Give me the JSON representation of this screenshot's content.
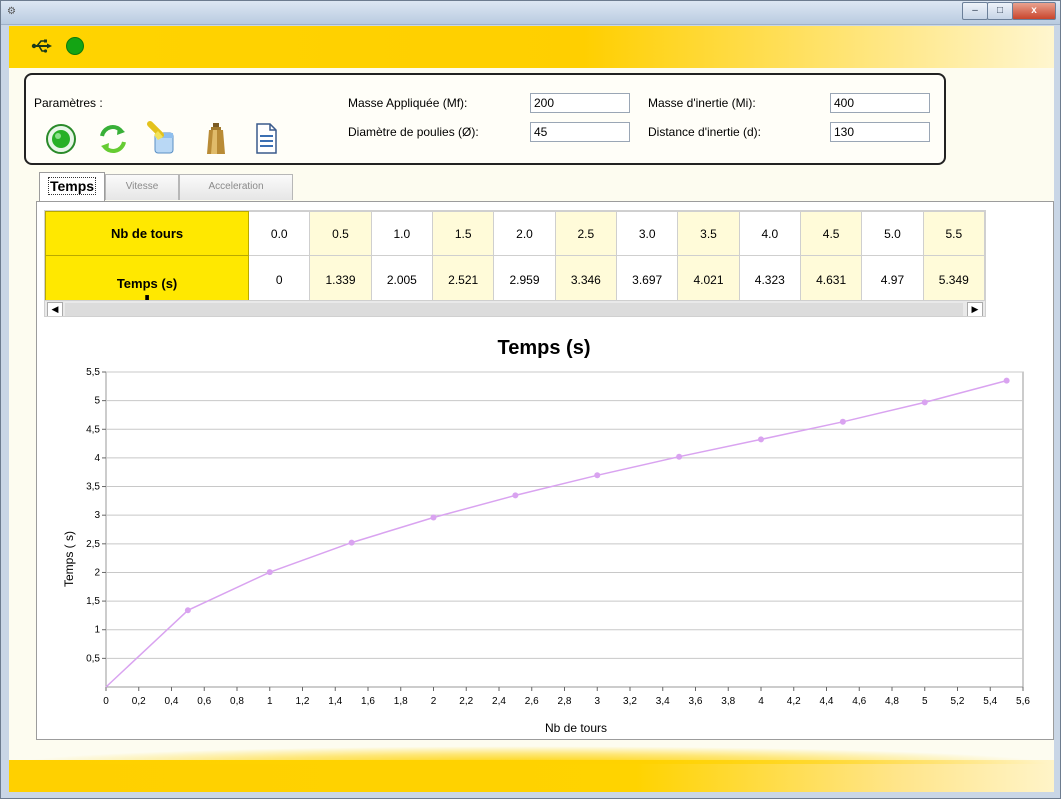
{
  "window": {
    "title": "",
    "buttons": {
      "minimize": "–",
      "maximize": "□",
      "close": "x"
    }
  },
  "header": {
    "status_color": "#14a414"
  },
  "params": {
    "title": "Paramètres :",
    "tools": [
      "start-icon",
      "refresh-icon",
      "clear-icon",
      "weight-icon",
      "document-icon"
    ],
    "fields": [
      {
        "label": "Masse Appliquée (Mf):",
        "value": "200"
      },
      {
        "label": "Masse d'inertie (Mi):",
        "value": "400"
      },
      {
        "label": "Diamètre de poulies (Ø):",
        "value": "45"
      },
      {
        "label": "Distance d'inertie (d):",
        "value": "130"
      }
    ]
  },
  "tabs": [
    {
      "label": "Temps",
      "active": true
    },
    {
      "label": "Vitesse",
      "active": false
    },
    {
      "label": "Acceleration",
      "active": false
    }
  ],
  "table": {
    "row_headers": [
      "Nb de tours",
      "Temps (s)"
    ],
    "nb_tours": [
      "0.0",
      "0.5",
      "1.0",
      "1.5",
      "2.0",
      "2.5",
      "3.0",
      "3.5",
      "4.0",
      "4.5",
      "5.0",
      "5.5"
    ],
    "temps": [
      "0",
      "1.339",
      "2.005",
      "2.521",
      "2.959",
      "3.346",
      "3.697",
      "4.021",
      "4.323",
      "4.631",
      "4.97",
      "5.349"
    ]
  },
  "chart_data": {
    "type": "line",
    "title": "Temps (s)",
    "xlabel": "Nb de tours",
    "ylabel": "Temps ( s)",
    "xlim": [
      0,
      5.6
    ],
    "ylim": [
      0,
      5.5
    ],
    "xticks": [
      "0",
      "0,2",
      "0,4",
      "0,6",
      "0,8",
      "1",
      "1,2",
      "1,4",
      "1,6",
      "1,8",
      "2",
      "2,2",
      "2,4",
      "2,6",
      "2,8",
      "3",
      "3,2",
      "3,4",
      "3,6",
      "3,8",
      "4",
      "4,2",
      "4,4",
      "4,6",
      "4,8",
      "5",
      "5,2",
      "5,4",
      "5,6"
    ],
    "yticks": [
      "0,5",
      "1",
      "1,5",
      "2",
      "2,5",
      "3",
      "3,5",
      "4",
      "4,5",
      "5",
      "5,5"
    ],
    "grid": true,
    "color": "#d9a3f0",
    "x": [
      0,
      0.5,
      1.0,
      1.5,
      2.0,
      2.5,
      3.0,
      3.5,
      4.0,
      4.5,
      5.0,
      5.5
    ],
    "y": [
      0,
      1.339,
      2.005,
      2.521,
      2.959,
      3.346,
      3.697,
      4.021,
      4.323,
      4.631,
      4.97,
      5.349
    ]
  }
}
